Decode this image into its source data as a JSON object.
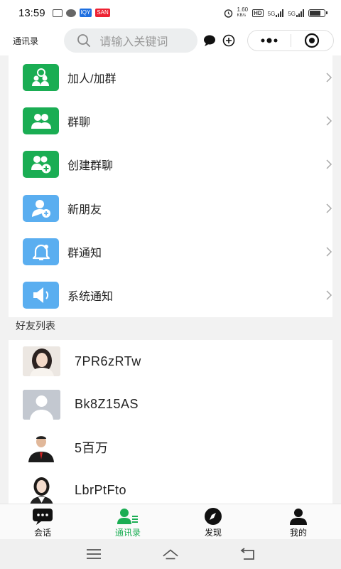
{
  "status_bar": {
    "time": "13:59",
    "speed": "1.60",
    "speed_unit": "KB/s",
    "net1": "5G",
    "net2": "5G",
    "hd": "HD"
  },
  "header": {
    "title": "通讯录",
    "search_placeholder": "请输入关键词"
  },
  "menu": [
    {
      "label": "加人/加群",
      "icon": "add-contact-icon",
      "color": "#1aad53"
    },
    {
      "label": "群聊",
      "icon": "group-chat-icon",
      "color": "#1aad53"
    },
    {
      "label": "创建群聊",
      "icon": "create-group-icon",
      "color": "#1aad53"
    },
    {
      "label": "新朋友",
      "icon": "new-friend-icon",
      "color": "#5aaef0"
    },
    {
      "label": "群通知",
      "icon": "bell-icon",
      "color": "#5aaef0"
    },
    {
      "label": "系统通知",
      "icon": "speaker-icon",
      "color": "#5aaef0"
    }
  ],
  "friends_section": {
    "title": "好友列表"
  },
  "friends": [
    {
      "name": "7PR6zRTw"
    },
    {
      "name": "Bk8Z15AS"
    },
    {
      "name": "5百万"
    },
    {
      "name": "LbrPtFto"
    }
  ],
  "tabs": [
    {
      "label": "会话",
      "icon": "chat-bubble-icon"
    },
    {
      "label": "通讯录",
      "icon": "contacts-icon",
      "active": true
    },
    {
      "label": "发现",
      "icon": "compass-icon"
    },
    {
      "label": "我的",
      "icon": "person-icon"
    }
  ],
  "colors": {
    "accent": "#1aad53",
    "blue": "#5aaef0"
  }
}
